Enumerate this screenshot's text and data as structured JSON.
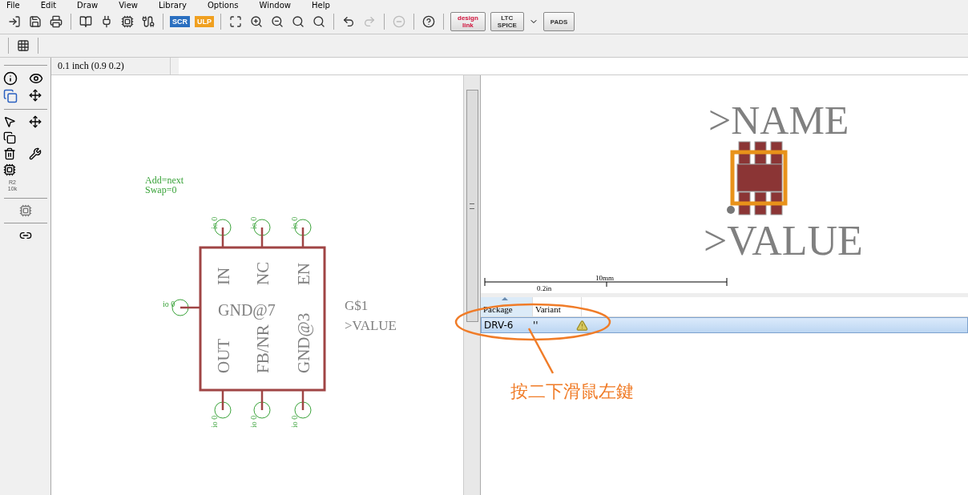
{
  "menu": [
    "File",
    "Edit",
    "Draw",
    "View",
    "Library",
    "Options",
    "Window",
    "Help"
  ],
  "toolbar": {
    "script_button": "SCR",
    "ulp_button": "ULP",
    "design_link": [
      "design",
      "link"
    ],
    "ltspice": [
      "LTC",
      "SPICE"
    ],
    "pads": "PADS"
  },
  "sidebar": {
    "value_tool": [
      "R2",
      "10k"
    ]
  },
  "status": {
    "grid": "0.1 inch (0.9 0.2)"
  },
  "schematic": {
    "smash_info": [
      "Add=next",
      "Swap=0"
    ],
    "top_pins": [
      {
        "name": "IN",
        "pad": "io 0"
      },
      {
        "name": "NC",
        "pad": "io 0"
      },
      {
        "name": "EN",
        "pad": "io 0"
      }
    ],
    "left_pin": {
      "name": "GND@7",
      "pad": "io 0"
    },
    "bottom_pins": [
      {
        "name": "OUT",
        "pad": "io 0"
      },
      {
        "name": "FB/NR",
        "pad": "io 0"
      },
      {
        "name": "GND@3",
        "pad": "io 0"
      }
    ],
    "part_name": "G$1",
    "part_value": ">VALUE"
  },
  "package_preview": {
    "name": ">NAME",
    "value": ">VALUE",
    "ruler_inch": "0.2in",
    "ruler_mm": "10mm"
  },
  "table": {
    "columns": [
      {
        "label": "Package",
        "sorted": true
      },
      {
        "label": "Variant",
        "sorted": false
      }
    ],
    "rows": [
      {
        "package": "DRV-6",
        "variant": "''",
        "warning": true,
        "selected": true
      }
    ]
  },
  "annotation": {
    "text": "按二下滑鼠左鍵"
  }
}
